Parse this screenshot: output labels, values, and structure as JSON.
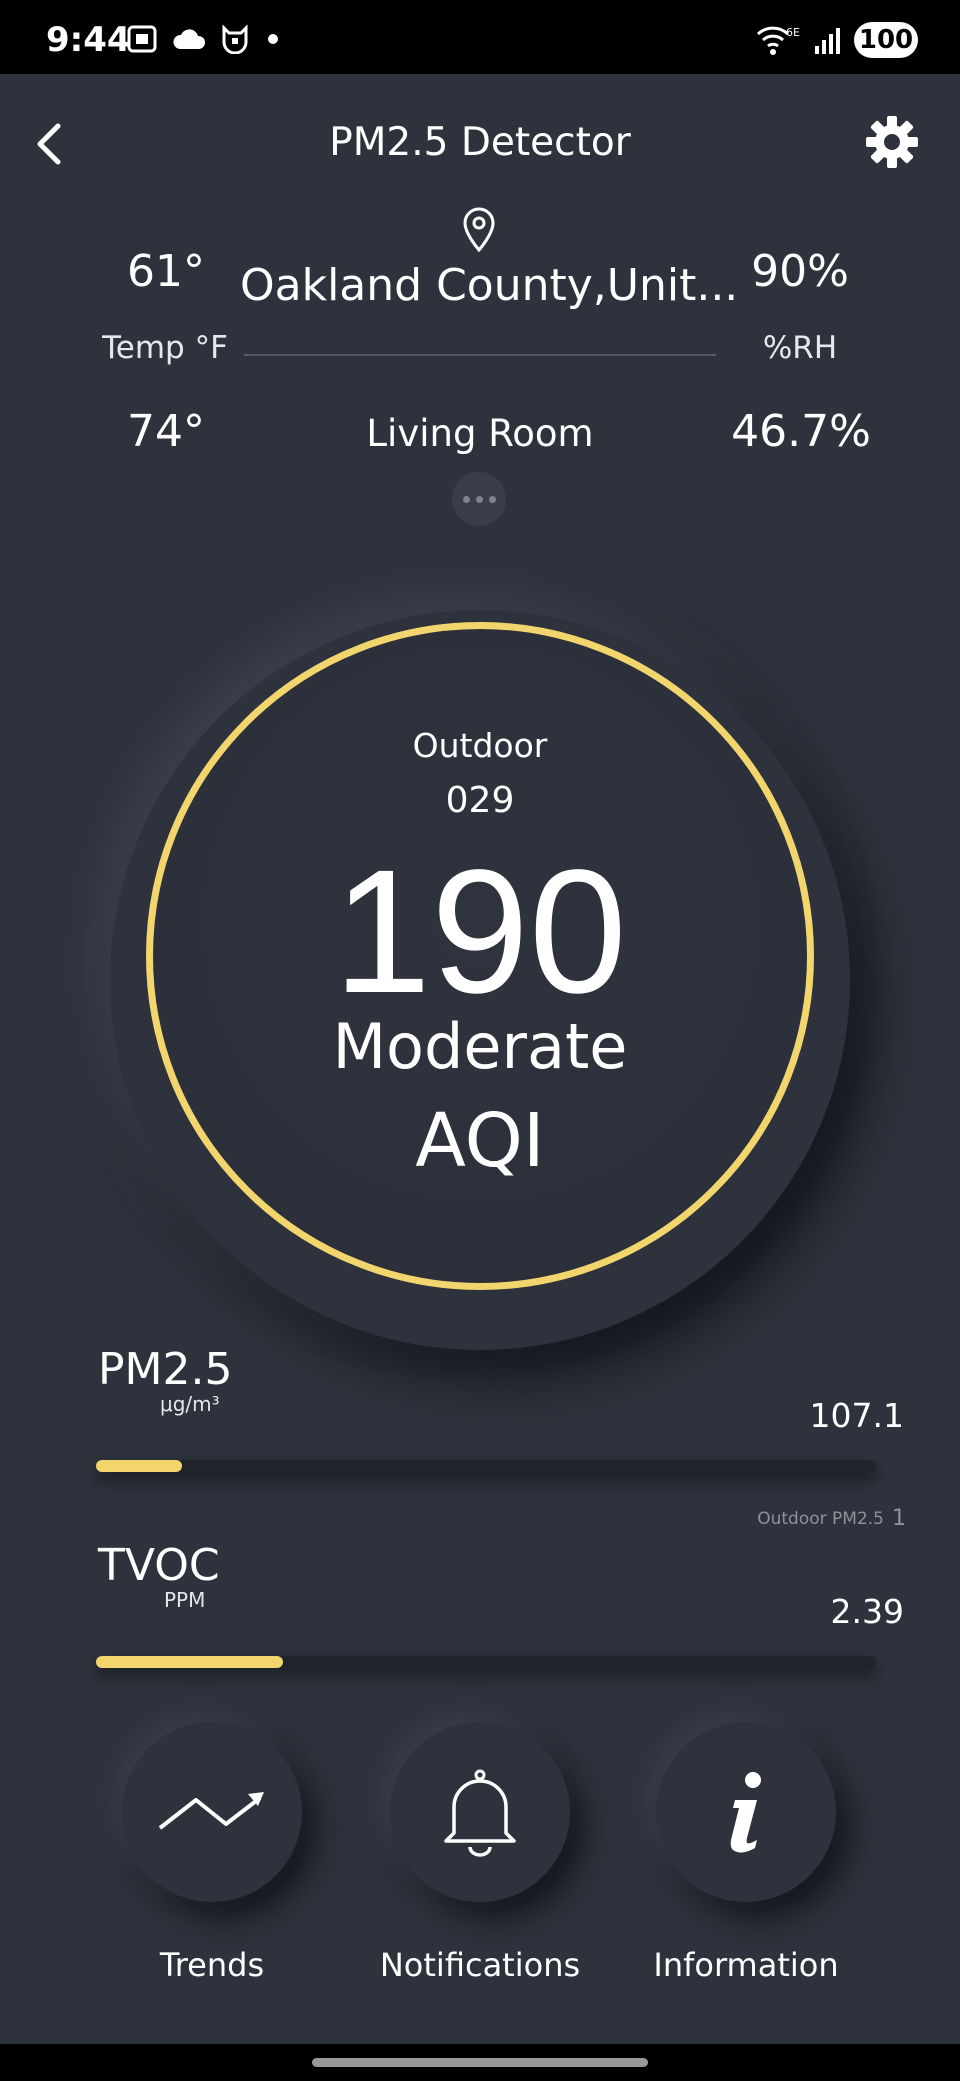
{
  "status_bar": {
    "time": "9:44",
    "battery": "100"
  },
  "header": {
    "title": "PM2.5 Detector"
  },
  "outdoor": {
    "temp": "61°",
    "humidity": "90%",
    "location": "Oakland County,Unit..."
  },
  "labels": {
    "temp": "Temp °F",
    "humidity": "%RH"
  },
  "indoor": {
    "temp": "74°",
    "humidity": "46.7%",
    "room": "Living Room"
  },
  "gauge": {
    "outdoor_label": "Outdoor",
    "outdoor_value": "029",
    "aqi": "190",
    "status": "Moderate",
    "unit": "AQI",
    "ring_color": "#f2d66d"
  },
  "metrics": [
    {
      "name": "PM2.5",
      "unit": "μg/m³",
      "value": "107.1",
      "fill_fraction": 0.11
    },
    {
      "name": "TVOC",
      "unit": "PPM",
      "value": "2.39",
      "fill_fraction": 0.24
    }
  ],
  "outdoor_note": {
    "label": "Outdoor PM2.5",
    "mark": "1"
  },
  "actions": [
    {
      "label": "Trends",
      "icon": "trend-icon"
    },
    {
      "label": "Notifications",
      "icon": "bell-icon"
    },
    {
      "label": "Information",
      "icon": "info-icon"
    }
  ]
}
